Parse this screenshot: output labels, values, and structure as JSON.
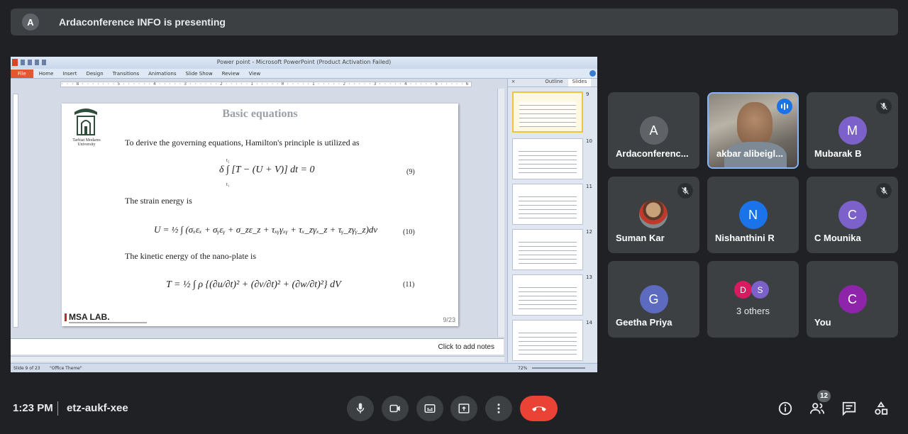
{
  "banner": {
    "avatar_letter": "A",
    "text": "Ardaconference INFO is presenting"
  },
  "ppt": {
    "window_title": "Power point - Microsoft PowerPoint (Product Activation Failed)",
    "tabs": [
      "File",
      "Home",
      "Insert",
      "Design",
      "Transitions",
      "Animations",
      "Slide Show",
      "Review",
      "View"
    ],
    "ruler_text": "· · · 8 · · · · · · · 5 · · · · · · 4 · · · · · 3 · · · · · · 2 · · · · · 1 · · · · · 0 · · · · · 1 · · · · · 2 · · · · · 3 · · · · · 4 · · · · · 5 · · · · · 6 · · ·",
    "panel_tabs": {
      "close": "×",
      "outline": "Outline",
      "slides": "Slides"
    },
    "thumb_numbers": [
      "9",
      "10",
      "11",
      "12",
      "13",
      "14"
    ],
    "notes_placeholder": "Click to add notes",
    "status_slide": "Slide 9 of 23",
    "status_theme": "\"Office Theme\"",
    "zoom": "72%",
    "slide": {
      "logo_text": "Tarbiat Modares University",
      "title": "Basic equations",
      "p1": "To derive the governing equations, Hamilton's principle is utilized as",
      "eq1": "δ ∫ [T − (U + V)] dt = 0",
      "eq1_limits_top": "t₂",
      "eq1_limits_bottom": "t₁",
      "eq1_num": "(9)",
      "p2": "The strain energy is",
      "eq2": "U = ½ ∫ (σₓεₓ + σᵧεᵧ + σ_zε_z + τₓᵧγₓᵧ + τₓ_zγₓ_z + τᵧ_zγᵧ_z)dv",
      "eq2_num": "(10)",
      "p3": "The kinetic energy of the nano-plate is",
      "eq3": "T = ½ ∫ ρ {(∂u/∂t)² + (∂v/∂t)² + (∂w/∂t)²} dV",
      "eq3_num": "(11)",
      "lab": "MSA LAB.",
      "page": "9/23"
    }
  },
  "participants": [
    {
      "name": "Ardaconferenc...",
      "letter": "A",
      "color": "#5f6368",
      "muted": false
    },
    {
      "name": "akbar alibeigl...",
      "video": true,
      "speaking": true
    },
    {
      "name": "Mubarak B",
      "letter": "M",
      "color": "#7b61c9",
      "muted": true
    },
    {
      "name": "Suman Kar",
      "photo": true,
      "muted": true
    },
    {
      "name": "Nishanthini R",
      "letter": "N",
      "color": "#1a73e8",
      "muted": false
    },
    {
      "name": "C Mounika",
      "letter": "C",
      "color": "#7b61c9",
      "muted": true
    },
    {
      "name": "Geetha Priya",
      "letter": "G",
      "color": "#5c6bc0",
      "muted": false
    },
    {
      "name": "3 others",
      "others": [
        "D",
        "S"
      ]
    },
    {
      "name": "You",
      "letter": "C",
      "color": "#8e24aa",
      "muted": false
    }
  ],
  "bottom": {
    "time": "1:23 PM",
    "meeting_code": "etz-aukf-xee",
    "participant_count": "12"
  },
  "colors": {
    "background": "#202124",
    "tile": "#3c4043",
    "end_call": "#ea4335",
    "speaking": "#1a73e8"
  }
}
